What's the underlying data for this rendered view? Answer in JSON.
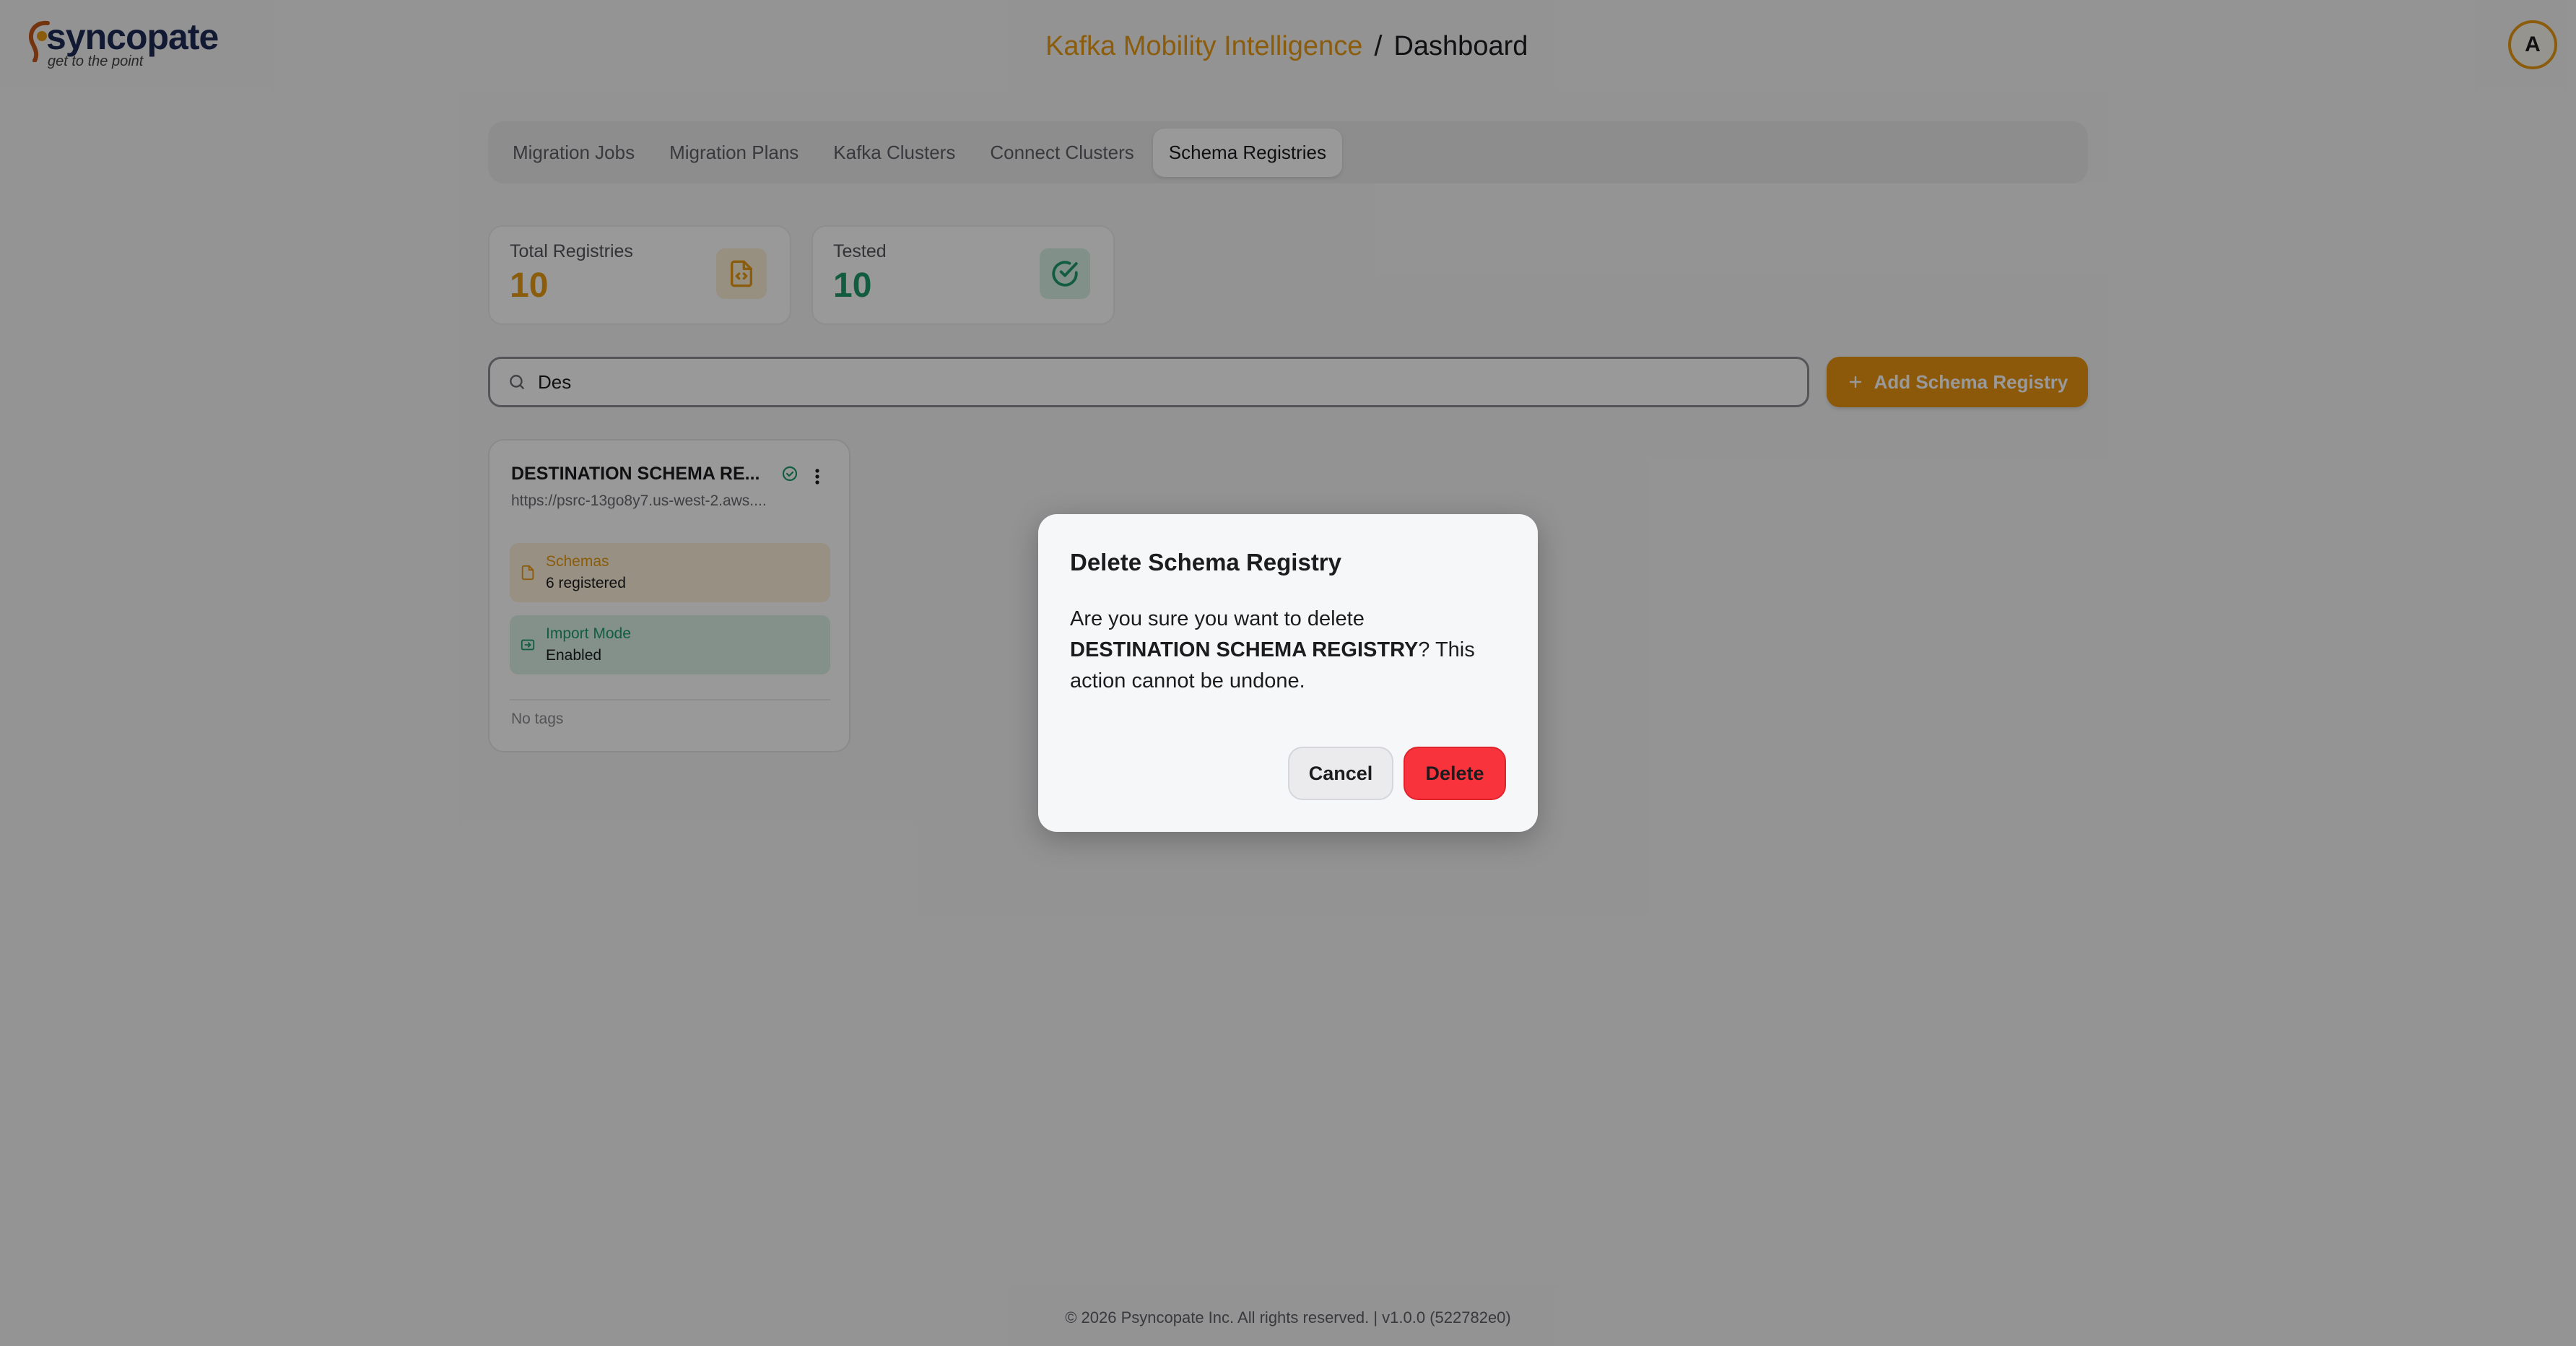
{
  "header": {
    "brand": "syncopate",
    "tagline": "get to the point",
    "app_title": "Kafka Mobility Intelligence",
    "separator": "/",
    "page_title": "Dashboard",
    "avatar_initial": "A",
    "accent_color": "#e89a13"
  },
  "tabs": [
    {
      "label": "Migration Jobs",
      "active": false
    },
    {
      "label": "Migration Plans",
      "active": false
    },
    {
      "label": "Kafka Clusters",
      "active": false
    },
    {
      "label": "Connect Clusters",
      "active": false
    },
    {
      "label": "Schema Registries",
      "active": true
    }
  ],
  "stats": {
    "total": {
      "label": "Total Registries",
      "value": "10",
      "icon": "file-code-icon"
    },
    "tested": {
      "label": "Tested",
      "value": "10",
      "icon": "check-circle-icon"
    }
  },
  "search": {
    "value": "Des",
    "icon": "search-icon"
  },
  "add_button": {
    "label": "Add Schema Registry",
    "icon": "plus-icon"
  },
  "registry_card": {
    "name": "DESTINATION SCHEMA RE...",
    "url": "https://psrc-13go8y7.us-west-2.aws....",
    "schemas_label": "Schemas",
    "schemas_value": "6 registered",
    "import_label": "Import Mode",
    "import_value": "Enabled",
    "tags": "No tags"
  },
  "dialog": {
    "title": "Delete Schema Registry",
    "body_prefix": "Are you sure you want to delete ",
    "body_name": "DESTINATION SCHEMA REGISTRY",
    "body_suffix": "? This action cannot be undone.",
    "cancel_label": "Cancel",
    "delete_label": "Delete",
    "delete_color": "#f8333c"
  },
  "footer": {
    "text": "© 2026 Psyncopate Inc. All rights reserved. | v1.0.0 (522782e0)"
  }
}
